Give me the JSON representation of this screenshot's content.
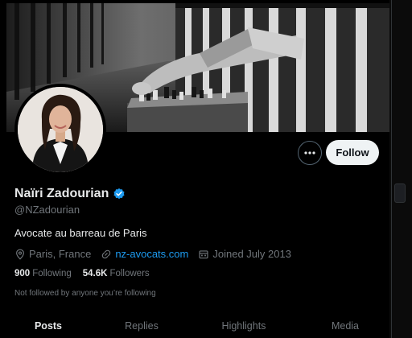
{
  "profile": {
    "name": "Naïri Zadourian",
    "handle": "@NZadourian",
    "bio": "Avocate au barreau de Paris",
    "location": "Paris, France",
    "website": "nz-avocats.com",
    "joined": "Joined July 2013",
    "following_count": "900",
    "following_label": "Following",
    "followers_count": "54.6K",
    "followers_label": "Followers",
    "followed_by_note": "Not followed by anyone you’re following",
    "verified": true
  },
  "actions": {
    "more_icon": "more-horizontal-icon",
    "follow_label": "Follow"
  },
  "tabs": [
    {
      "label": "Posts",
      "active": true
    },
    {
      "label": "Replies",
      "active": false
    },
    {
      "label": "Highlights",
      "active": false
    },
    {
      "label": "Media",
      "active": false
    }
  ],
  "colors": {
    "accent": "#1d9bf0",
    "background": "#000000",
    "primary_text": "#e7e9ea",
    "secondary_text": "#71767b"
  },
  "icons": {
    "verified": "verified-badge-icon",
    "location": "location-pin-icon",
    "link": "link-icon",
    "calendar": "calendar-icon"
  }
}
